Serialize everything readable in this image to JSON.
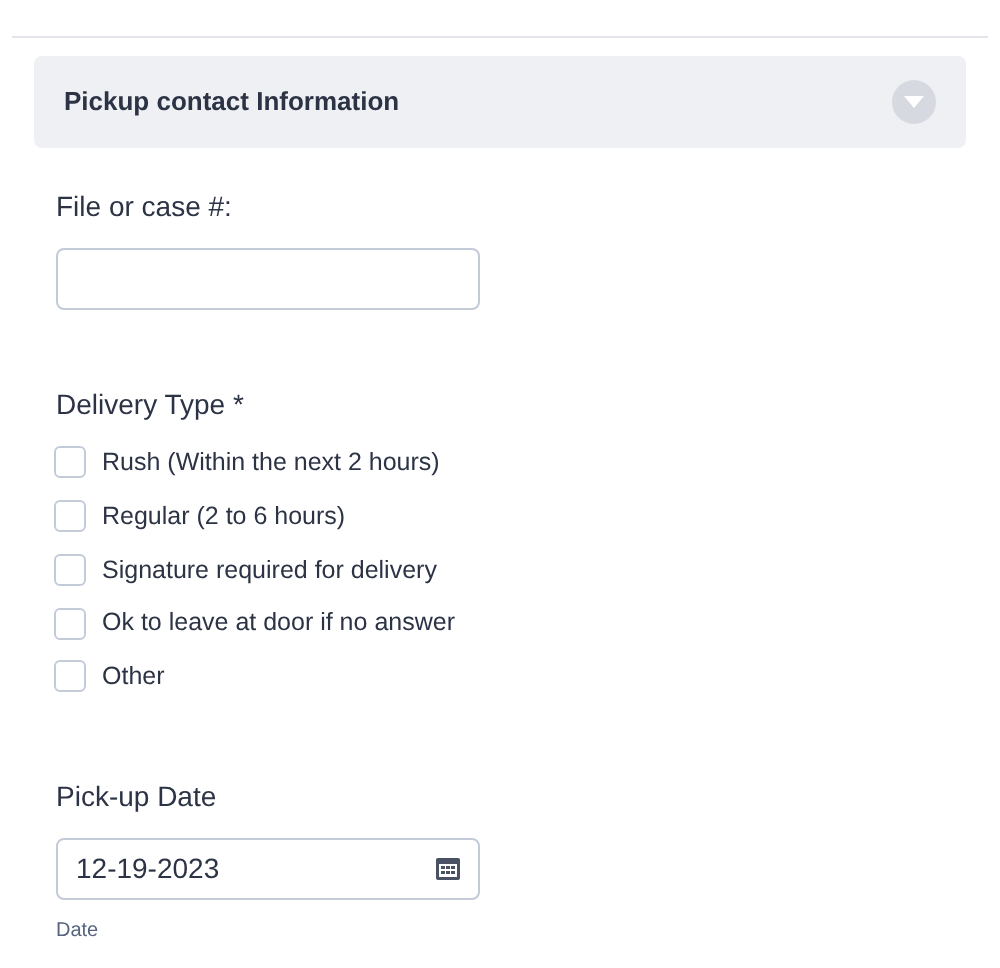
{
  "section": {
    "title": "Pickup contact Information",
    "expanded": false
  },
  "file_field": {
    "label": "File or case #:"
  },
  "delivery_type": {
    "label": "Delivery Type *",
    "options": [
      {
        "label": "Rush (Within the next 2 hours)",
        "checked": false
      },
      {
        "label": "Regular (2 to 6 hours)",
        "checked": false
      },
      {
        "label": "Signature required for delivery",
        "checked": false
      },
      {
        "label": "Ok to leave at door if no answer",
        "checked": false
      },
      {
        "label": "Other",
        "checked": false
      }
    ]
  },
  "pickup_date": {
    "label": "Pick-up Date",
    "value": "12-19-2023",
    "hint": "Date"
  }
}
